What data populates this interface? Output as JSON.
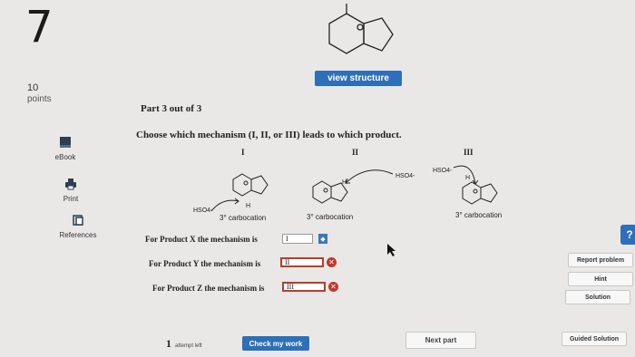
{
  "question_number": "7",
  "points": {
    "value": "10",
    "label": "points"
  },
  "view_structure_label": "view structure",
  "part_label": "Part 3 out of 3",
  "question_text": "Choose which mechanism (I, II, or III) leads to which product.",
  "sidebar": [
    {
      "label": "eBook",
      "icon": "book-icon"
    },
    {
      "label": "Print",
      "icon": "printer-icon"
    },
    {
      "label": "References",
      "icon": "references-icon"
    }
  ],
  "mechanisms": [
    {
      "label": "I",
      "reagent": "HSO4-",
      "carbocation": "3° carbocation"
    },
    {
      "label": "II",
      "reagent": "HSO4-",
      "carbocation": "3° carbocation"
    },
    {
      "label": "III",
      "reagent": "HSO4-",
      "carbocation": "3° carbocation"
    }
  ],
  "atom_labels": {
    "h": "H"
  },
  "answers": [
    {
      "label": "For Product X the mechanism is",
      "value": "I",
      "incorrect": false
    },
    {
      "label": "For Product Y the mechanism is",
      "value": "II",
      "incorrect": true
    },
    {
      "label": "For Product Z the mechanism is",
      "value": "III",
      "incorrect": true
    }
  ],
  "right_buttons": [
    "Report problem",
    "Hint",
    "Solution",
    "Guided Solution"
  ],
  "help_label": "?",
  "attempts": {
    "count": "1",
    "label": "attempt left"
  },
  "check_label": "Check my work",
  "next_label": "Next part",
  "colors": {
    "accent": "#2d6fb8",
    "error": "#c0392b"
  }
}
